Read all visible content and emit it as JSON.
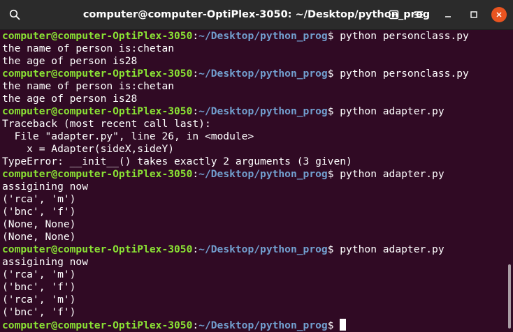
{
  "window": {
    "title": "computer@computer-OptiPlex-3050: ~/Desktop/python_prog",
    "icons": {
      "search": "search-icon",
      "new_tab": "new-tab-icon",
      "menu": "hamburger-menu-icon",
      "minimize": "minimize-icon",
      "maximize": "maximize-icon",
      "close": "close-icon"
    },
    "colors": {
      "background": "#300a24",
      "prompt_user": "#8ae234",
      "prompt_path": "#729fcf",
      "text": "#ffffff",
      "close_button": "#e95420",
      "titlebar": "#2b2b2b"
    }
  },
  "terminal": {
    "prompt_user": "computer@computer-OptiPlex-3050",
    "prompt_sep": ":",
    "prompt_path": "~/Desktop/python_prog",
    "prompt_symbol": "$ ",
    "lines": [
      {
        "type": "prompt",
        "cmd": "python personclass.py"
      },
      {
        "type": "out",
        "text": "the name of person is:chetan"
      },
      {
        "type": "out",
        "text": "the age of person is28"
      },
      {
        "type": "prompt",
        "cmd": "python personclass.py"
      },
      {
        "type": "out",
        "text": "the name of person is:chetan"
      },
      {
        "type": "out",
        "text": "the age of person is28"
      },
      {
        "type": "prompt",
        "cmd": "python adapter.py"
      },
      {
        "type": "out",
        "text": "Traceback (most recent call last):"
      },
      {
        "type": "out",
        "text": "  File \"adapter.py\", line 26, in <module>"
      },
      {
        "type": "out",
        "text": "    x = Adapter(sideX,sideY)"
      },
      {
        "type": "out",
        "text": "TypeError: __init__() takes exactly 2 arguments (3 given)"
      },
      {
        "type": "prompt",
        "cmd": "python adapter.py"
      },
      {
        "type": "out",
        "text": "assigining now"
      },
      {
        "type": "out",
        "text": "('rca', 'm')"
      },
      {
        "type": "out",
        "text": "('bnc', 'f')"
      },
      {
        "type": "out",
        "text": "(None, None)"
      },
      {
        "type": "out",
        "text": "(None, None)"
      },
      {
        "type": "prompt",
        "cmd": "python adapter.py"
      },
      {
        "type": "out",
        "text": "assigining now"
      },
      {
        "type": "out",
        "text": "('rca', 'm')"
      },
      {
        "type": "out",
        "text": "('bnc', 'f')"
      },
      {
        "type": "out",
        "text": "('rca', 'm')"
      },
      {
        "type": "out",
        "text": "('bnc', 'f')"
      },
      {
        "type": "prompt",
        "cmd": "",
        "cursor": true
      }
    ]
  }
}
